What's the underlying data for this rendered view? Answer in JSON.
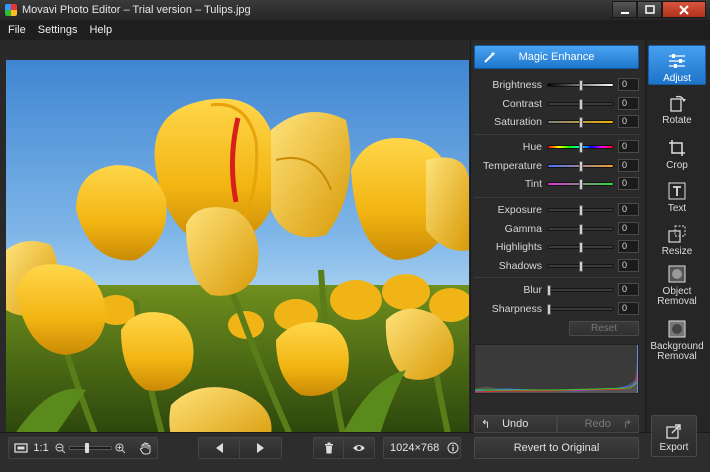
{
  "window": {
    "title": "Movavi Photo Editor – Trial version – Tulips.jpg"
  },
  "menu": [
    {
      "id": "file",
      "label": "File"
    },
    {
      "id": "settings",
      "label": "Settings"
    },
    {
      "id": "help",
      "label": "Help"
    }
  ],
  "adjust": {
    "magic_label": "Magic Enhance",
    "groups": [
      [
        {
          "id": "brightness",
          "label": "Brightness",
          "value": "0",
          "level": 0.5,
          "gradient": "bw"
        },
        {
          "id": "contrast",
          "label": "Contrast",
          "value": "0",
          "level": 0.5,
          "gradient": "plain"
        },
        {
          "id": "saturation",
          "label": "Saturation",
          "value": "0",
          "level": 0.5,
          "gradient": "sat"
        }
      ],
      [
        {
          "id": "hue",
          "label": "Hue",
          "value": "0",
          "level": 0.5,
          "gradient": "hue"
        },
        {
          "id": "temperature",
          "label": "Temperature",
          "value": "0",
          "level": 0.5,
          "gradient": "temp"
        },
        {
          "id": "tint",
          "label": "Tint",
          "value": "0",
          "level": 0.5,
          "gradient": "tint"
        }
      ],
      [
        {
          "id": "exposure",
          "label": "Exposure",
          "value": "0",
          "level": 0.5,
          "gradient": "plain"
        },
        {
          "id": "gamma",
          "label": "Gamma",
          "value": "0",
          "level": 0.5,
          "gradient": "plain"
        },
        {
          "id": "highlights",
          "label": "Highlights",
          "value": "0",
          "level": 0.5,
          "gradient": "plain"
        },
        {
          "id": "shadows",
          "label": "Shadows",
          "value": "0",
          "level": 0.5,
          "gradient": "plain"
        }
      ],
      [
        {
          "id": "blur",
          "label": "Blur",
          "value": "0",
          "level": 0,
          "gradient": "plain"
        },
        {
          "id": "sharpness",
          "label": "Sharpness",
          "value": "0",
          "level": 0,
          "gradient": "plain"
        }
      ]
    ],
    "reset_label": "Reset",
    "undo_label": "Undo",
    "redo_label": "Redo",
    "revert_label": "Revert to Original"
  },
  "tools": [
    {
      "id": "adjust",
      "label": "Adjust",
      "icon": "sliders-icon",
      "active": true
    },
    {
      "id": "rotate",
      "label": "Rotate",
      "icon": "rotate-icon",
      "active": false
    },
    {
      "id": "crop",
      "label": "Crop",
      "icon": "crop-icon",
      "active": false
    },
    {
      "id": "text",
      "label": "Text",
      "icon": "text-icon",
      "active": false
    },
    {
      "id": "resize",
      "label": "Resize",
      "icon": "resize-icon",
      "active": false
    },
    {
      "id": "object-removal",
      "label": "Object Removal",
      "icon": "object-removal-icon",
      "active": false
    },
    {
      "id": "background-removal",
      "label": "Background Removal",
      "icon": "background-removal-icon",
      "active": false
    }
  ],
  "export_label": "Export",
  "statusbar": {
    "zoom_label": "1:1",
    "zoom_level": 0.35,
    "image_size": "1024×768"
  },
  "colors": {
    "accent": "#2a86de",
    "close": "#c9432b"
  }
}
